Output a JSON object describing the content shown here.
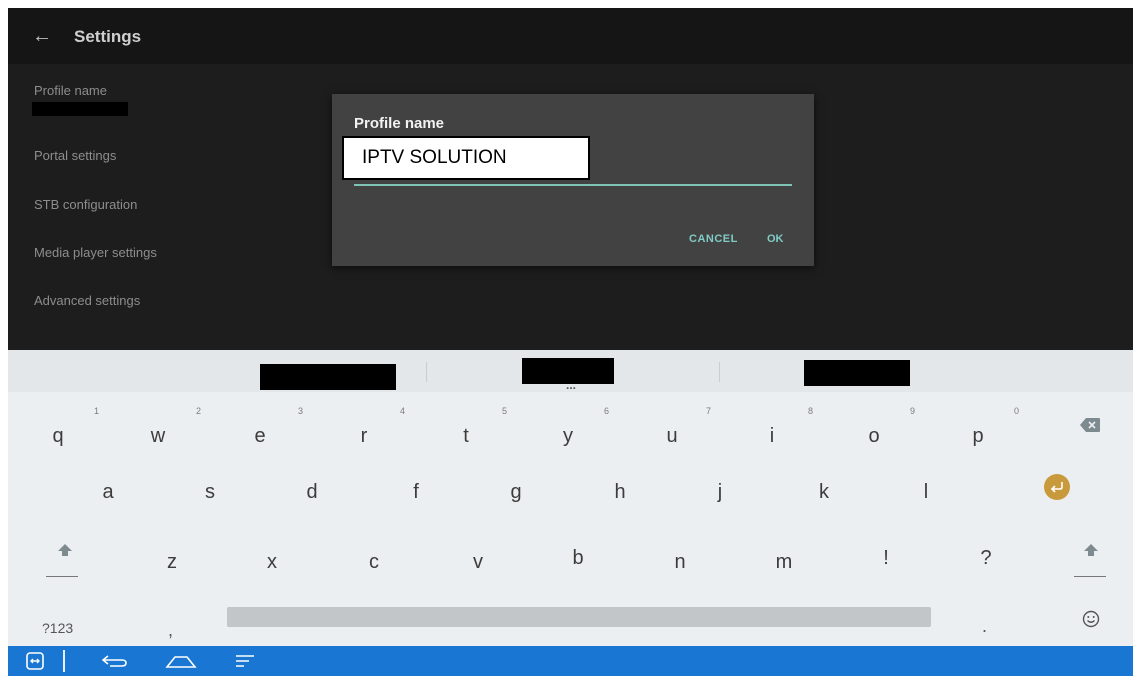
{
  "app": {
    "title": "Settings",
    "back_icon": "arrow-left-icon"
  },
  "settings_items": [
    {
      "label": "Profile name"
    },
    {
      "label": "Portal settings"
    },
    {
      "label": "STB configuration"
    },
    {
      "label": "Media player settings"
    },
    {
      "label": "Advanced settings"
    }
  ],
  "dialog": {
    "title": "Profile name",
    "input_value": "IPTV SOLUTION",
    "cancel_label": "CANCEL",
    "ok_label": "OK"
  },
  "keyboard": {
    "more_indicator": "...",
    "row1": [
      {
        "key": "q",
        "hint": "1"
      },
      {
        "key": "w",
        "hint": "2"
      },
      {
        "key": "e",
        "hint": "3"
      },
      {
        "key": "r",
        "hint": "4"
      },
      {
        "key": "t",
        "hint": "5"
      },
      {
        "key": "y",
        "hint": "6"
      },
      {
        "key": "u",
        "hint": "7"
      },
      {
        "key": "i",
        "hint": "8"
      },
      {
        "key": "o",
        "hint": "9"
      },
      {
        "key": "p",
        "hint": "0"
      }
    ],
    "row2": [
      "a",
      "s",
      "d",
      "f",
      "g",
      "h",
      "j",
      "k",
      "l"
    ],
    "row3": [
      "z",
      "x",
      "c",
      "v",
      "b",
      "n",
      "m",
      "!",
      "?"
    ],
    "mode_key": "?123",
    "comma_key": ",",
    "period_key": ".",
    "icons": {
      "backspace": "backspace-icon",
      "enter": "enter-icon",
      "shift": "shift-icon",
      "emoji": "emoji-icon"
    },
    "enter_color": "#c89a3c"
  },
  "navbar": {
    "color": "#1976d2",
    "icons": [
      "input-method-icon",
      "back-icon",
      "home-icon",
      "recents-icon"
    ]
  }
}
